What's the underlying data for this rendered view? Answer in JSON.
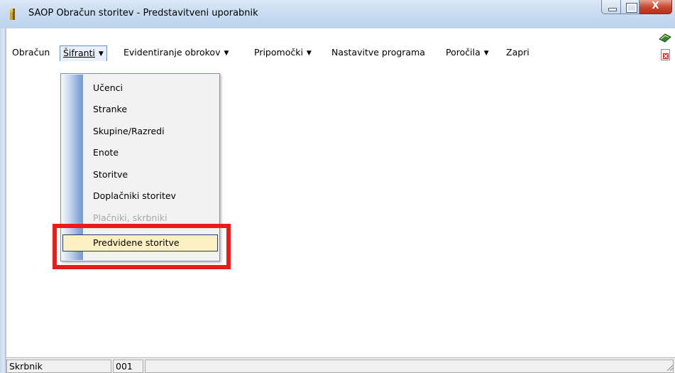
{
  "window": {
    "title": "SAOP Obračun storitev - Predstavitveni uporabnik",
    "close_label": "X"
  },
  "menu": {
    "items": [
      {
        "label": "Obračun",
        "has_arrow": false
      },
      {
        "label": "Šifranti",
        "has_arrow": true,
        "active": true
      },
      {
        "label": "Evidentiranje obrokov",
        "has_arrow": true
      },
      {
        "label": "Pripomočki",
        "has_arrow": true
      },
      {
        "label": "Nastavitve programa",
        "has_arrow": false
      },
      {
        "label": "Poročila",
        "has_arrow": true
      },
      {
        "label": "Zapri",
        "has_arrow": false
      }
    ],
    "arrow_glyph": "▼"
  },
  "dropdown": {
    "items": [
      {
        "label": "Učenci",
        "enabled": true
      },
      {
        "label": "Stranke",
        "enabled": true
      },
      {
        "label": "Skupine/Razredi",
        "enabled": true
      },
      {
        "label": "Enote",
        "enabled": true
      },
      {
        "label": "Storitve",
        "enabled": true
      },
      {
        "label": "Doplačniki storitev",
        "enabled": true
      },
      {
        "label": "Plačniki, skrbniki",
        "enabled": false
      },
      {
        "label": "Predvidene storitve",
        "enabled": true,
        "selected": true
      }
    ]
  },
  "status_bar": {
    "user": "Skrbnik",
    "code": "001",
    "extra": ""
  },
  "colors": {
    "highlight": "#ee1a1a",
    "selection_fill": "#fdf1c3",
    "selection_border": "#283a68",
    "disabled_text": "#a7a7a7"
  },
  "icons": [
    "app-icon",
    "minimize-icon",
    "maximize-icon",
    "close-icon",
    "toolbar-book-icon",
    "toolbar-exit-icon",
    "resize-grip-icon"
  ]
}
